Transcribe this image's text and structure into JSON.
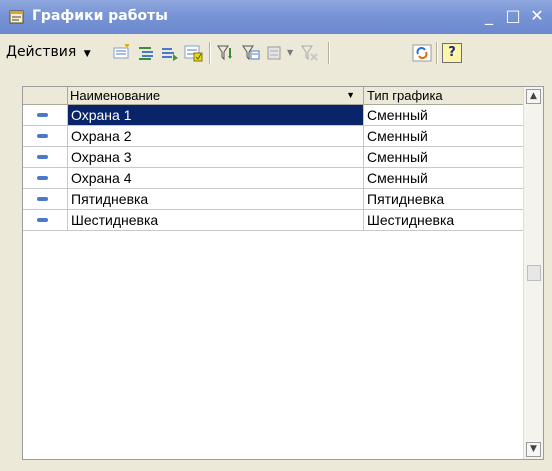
{
  "window": {
    "title": "Графики работы",
    "minimize_glyph": "_",
    "maximize_glyph": "□",
    "close_glyph": "✕"
  },
  "toolbar": {
    "actions_label": "Действия",
    "help_label": "?",
    "icons": [
      "add-row-icon",
      "add-group-icon",
      "copy-row-icon",
      "edit-row-icon",
      "filter-icon",
      "filter-settings-icon",
      "mark-delete-icon",
      "clear-filter-icon",
      "refresh-icon",
      "help-icon"
    ]
  },
  "table": {
    "columns": [
      "Наименование",
      "Тип графика"
    ],
    "rows": [
      {
        "name": "Охрана 1",
        "type": "Сменный",
        "selected": true
      },
      {
        "name": "Охрана 2",
        "type": "Сменный",
        "selected": false
      },
      {
        "name": "Охрана 3",
        "type": "Сменный",
        "selected": false
      },
      {
        "name": "Охрана 4",
        "type": "Сменный",
        "selected": false
      },
      {
        "name": "Пятидневка",
        "type": "Пятидневка",
        "selected": false
      },
      {
        "name": "Шестидневка",
        "type": "Шестидневка",
        "selected": false
      }
    ]
  },
  "colors": {
    "titlebar": "#7a96d6",
    "selection": "#0a246a",
    "row_marker": "#4c78c9"
  }
}
